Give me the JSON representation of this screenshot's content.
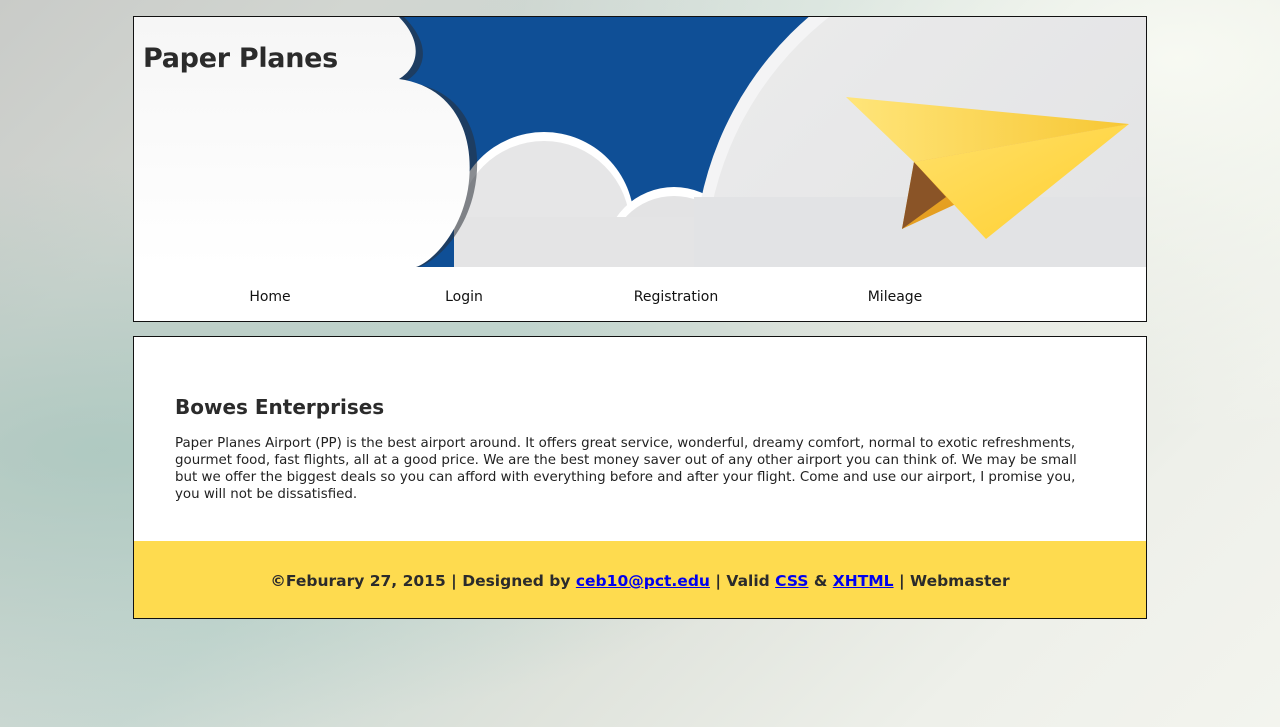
{
  "header": {
    "site_title": "Paper Planes",
    "nav": [
      {
        "label": "Home"
      },
      {
        "label": "Login"
      },
      {
        "label": "Registration"
      },
      {
        "label": "Mileage"
      }
    ]
  },
  "main": {
    "heading": "Bowes Enterprises",
    "body": "Paper Planes Airport (PP) is the best airport around. It offers great service, wonderful, dreamy comfort, normal to exotic refreshments, gourmet food, fast flights, all at a good price. We are the best money saver out of any other airport you can think of. We may be small but we offer the biggest deals so you can afford with everything before and after your flight. Come and use our airport, I promise you, you will not be dissatisfied."
  },
  "footer": {
    "date": "©Feburary 27, 2015",
    "sep1": " | ",
    "designed_by": "Designed by ",
    "email": "ceb10@pct.edu",
    "sep2": " | ",
    "valid": "Valid ",
    "css": "CSS",
    "amp": " & ",
    "xhtml": "XHTML",
    "sep3": " | ",
    "webmaster": "Webmaster"
  },
  "colors": {
    "sky": "#0f4f96",
    "footer_bg": "#fedb4f",
    "plane_light": "#ffd84a",
    "plane_dark": "#8a5427",
    "link": "#0000ee"
  },
  "icons": {
    "banner_art": "clouds-and-paper-plane"
  }
}
